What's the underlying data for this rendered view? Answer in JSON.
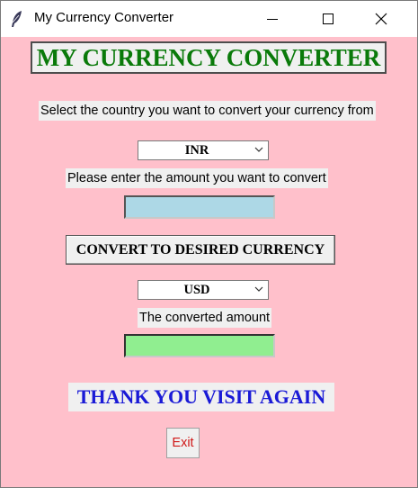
{
  "window": {
    "title": "My Currency Converter",
    "background_color": "#ffc0cb"
  },
  "titlebar": {
    "app_icon": "feather-icon",
    "minimize_icon": "minimize-icon",
    "maximize_icon": "maximize-icon",
    "close_icon": "close-icon"
  },
  "heading": {
    "text": "MY CURRENCY CONVERTER",
    "color": "#0a7a0a"
  },
  "from_prompt": {
    "text": "Select the country you want to convert your currency from"
  },
  "from_currency": {
    "selected": "INR"
  },
  "amount_prompt": {
    "text": "Please enter the amount you want to convert"
  },
  "amount_input": {
    "value": "",
    "background_color": "#add8e6"
  },
  "convert_button": {
    "label": "CONVERT TO DESIRED CURRENCY"
  },
  "to_currency": {
    "selected": "USD"
  },
  "result_label": {
    "text": "The converted amount"
  },
  "result_output": {
    "value": "",
    "background_color": "#90ee90"
  },
  "thanks": {
    "text": "THANK YOU VISIT AGAIN",
    "color": "#1a1ad6"
  },
  "exit_button": {
    "label": "Exit",
    "color": "#d01818"
  }
}
